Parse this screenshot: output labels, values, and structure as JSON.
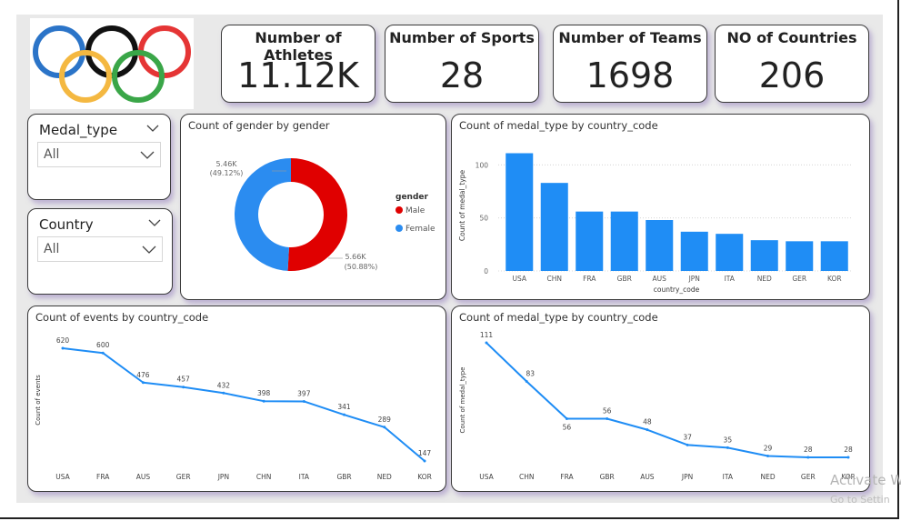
{
  "kpis": [
    {
      "title": "Number of Athletes",
      "value": "11.12K"
    },
    {
      "title": "Number of Sports",
      "value": "28"
    },
    {
      "title": "Number of Teams",
      "value": "1698"
    },
    {
      "title": "NO of Countries",
      "value": "206"
    }
  ],
  "slicers": [
    {
      "label": "Medal_type",
      "selected": "All"
    },
    {
      "label": "Country",
      "selected": "All"
    }
  ],
  "olympic_ring_colors": [
    "#2b74c8",
    "#111111",
    "#e53535",
    "#f4b841",
    "#3aa648"
  ],
  "charts": {
    "gender": {
      "title": "Count of gender by gender",
      "legend_title": "gender",
      "male_label": "5.66K",
      "male_pct": "(50.88%)",
      "female_label": "5.46K",
      "female_pct": "(49.12%)"
    },
    "medal_bar": {
      "title": "Count of medal_type by country_code",
      "ylabel": "Count of medal_type",
      "xlabel": "country_code"
    },
    "events_line": {
      "title": "Count of events by country_code",
      "ylabel": "Count of events"
    },
    "medal_line": {
      "title": "Count of medal_type by country_code",
      "ylabel": "Count of medal_type"
    }
  },
  "chart_data": [
    {
      "type": "pie",
      "title": "Count of gender by gender",
      "categories": [
        "Male",
        "Female"
      ],
      "values": [
        5660,
        5460
      ],
      "colors": [
        "#e00000",
        "#2b8cf0"
      ],
      "legend": "right"
    },
    {
      "type": "bar",
      "title": "Count of medal_type by country_code",
      "categories": [
        "USA",
        "CHN",
        "FRA",
        "GBR",
        "AUS",
        "JPN",
        "ITA",
        "NED",
        "GER",
        "KOR"
      ],
      "values": [
        111,
        83,
        56,
        56,
        48,
        37,
        35,
        29,
        28,
        28
      ],
      "xlabel": "country_code",
      "ylabel": "Count of medal_type",
      "yticks": [
        0,
        50,
        100
      ],
      "ylim": [
        0,
        120
      ],
      "color": "#1f8df5"
    },
    {
      "type": "line",
      "title": "Count of events by country_code",
      "categories": [
        "USA",
        "FRA",
        "AUS",
        "GER",
        "JPN",
        "CHN",
        "ITA",
        "GBR",
        "NED",
        "KOR"
      ],
      "values": [
        620,
        600,
        476,
        457,
        432,
        398,
        397,
        341,
        289,
        147
      ],
      "ylabel": "Count of events",
      "color": "#1f8df5"
    },
    {
      "type": "line",
      "title": "Count of medal_type by country_code",
      "categories": [
        "USA",
        "CHN",
        "FRA",
        "GBR",
        "AUS",
        "JPN",
        "ITA",
        "NED",
        "GER",
        "KOR"
      ],
      "values": [
        111,
        83,
        56,
        56,
        48,
        37,
        35,
        29,
        28,
        28
      ],
      "ylabel": "Count of medal_type",
      "color": "#1f8df5"
    }
  ],
  "watermark": {
    "line1": "Activate W",
    "line2": "Go to Settin"
  }
}
